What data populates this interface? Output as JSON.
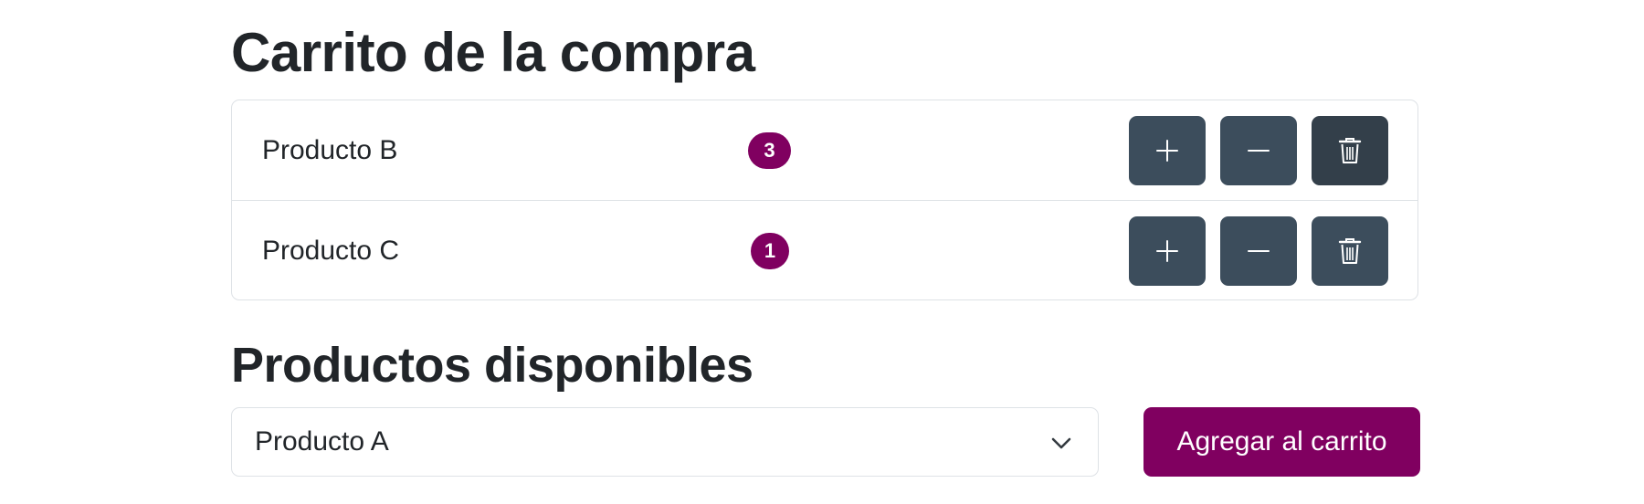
{
  "title": "Carrito de la compra",
  "cart": {
    "items": [
      {
        "name": "Producto B",
        "quantity": "3"
      },
      {
        "name": "Producto C",
        "quantity": "1"
      }
    ]
  },
  "icons": {
    "increase": "plus-icon",
    "decrease": "minus-icon",
    "remove": "trash-icon",
    "dropdown": "chevron-down-icon"
  },
  "available": {
    "heading": "Productos disponibles",
    "selected": "Producto A",
    "add_label": "Agregar al carrito"
  },
  "colors": {
    "accent": "#800060",
    "button": "#3c4d5c",
    "text": "#212529",
    "border": "#dee2e6"
  }
}
